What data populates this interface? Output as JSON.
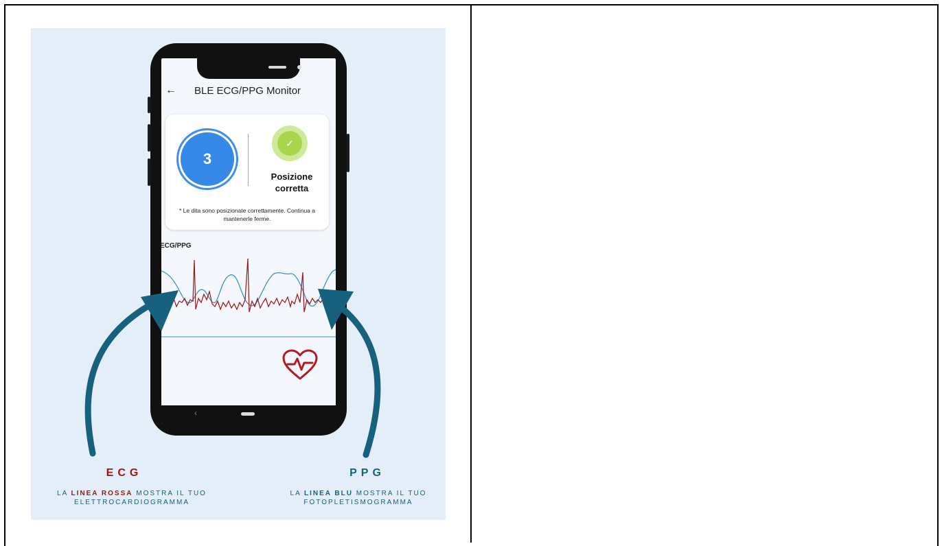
{
  "app": {
    "title": "BLE ECG/PPG Monitor",
    "back_icon": "arrow-left-icon"
  },
  "status_card": {
    "countdown": "3",
    "position_status": "Posizione corretta",
    "note": "* Le dita sono posizionate correttamente. Continua a mantenerle ferme."
  },
  "chart": {
    "label": "ECG/PPG"
  },
  "annotations": {
    "ecg": {
      "title": "ECG",
      "desc_prefix": "LA",
      "desc_highlight": "LINEA ROSSA",
      "desc_suffix": "MOSTRA IL TUO ELETTROCARDIOGRAMMA"
    },
    "ppg": {
      "title": "PPG",
      "desc_prefix": "LA",
      "desc_highlight": "LINEA BLU",
      "desc_suffix": "MOSTRA IL TUO FOTOPLETISMOGRAMMA"
    }
  },
  "colors": {
    "ecg_line": "#9a1616",
    "ppg_line": "#3b8fd8",
    "arrow": "#17607e",
    "counter": "#3689e6",
    "check": "#a9d64a"
  }
}
